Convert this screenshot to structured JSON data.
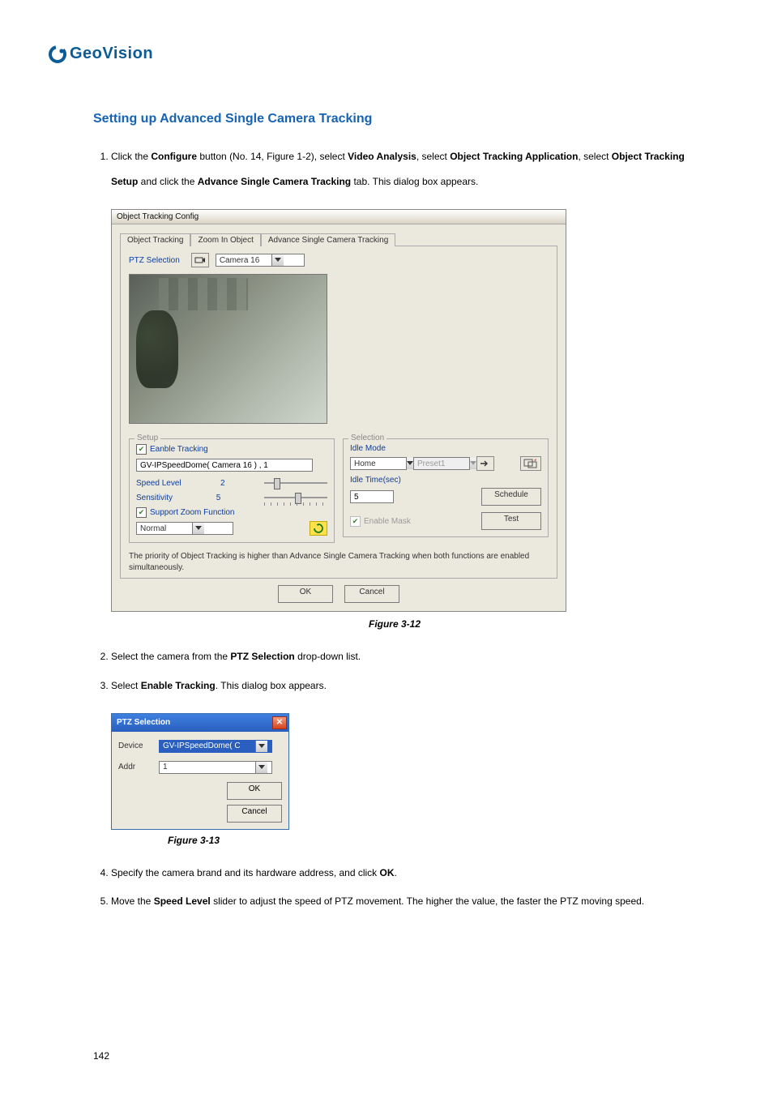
{
  "brand": "GeoVision",
  "section_title": "Setting up Advanced Single Camera Tracking",
  "step1": {
    "pre": "Click the ",
    "b1": "Configure",
    "mid1": " button (No. 14, Figure 1-2), select ",
    "b2": "Video Analysis",
    "mid2": ", select ",
    "b3": "Object Tracking Application",
    "mid3": ", select ",
    "b4": "Object Tracking Setup",
    "mid4": " and click the ",
    "b5": "Advance Single Camera Tracking",
    "mid5": " tab. This dialog box appears."
  },
  "dlg1": {
    "title": "Object Tracking Config",
    "tabs": {
      "t1": "Object Tracking",
      "t2": "Zoom In Object",
      "t3": "Advance Single Camera Tracking"
    },
    "ptz_label": "PTZ Selection",
    "camera": "Camera 16",
    "setup": {
      "legend": "Setup",
      "enable_tracking": "Eanble Tracking",
      "device_line": "GV-IPSpeedDome( Camera 16 ) , 1",
      "speed_label": "Speed Level",
      "speed_val": "2",
      "sens_label": "Sensitivity",
      "sens_val": "5",
      "support_zoom": "Support Zoom Function",
      "normal": "Normal"
    },
    "selection": {
      "legend": "Selection",
      "idle_mode_label": "Idle Mode",
      "idle_mode": "Home",
      "preset": "Preset1",
      "idle_time_label": "Idle Time(sec)",
      "idle_time_val": "5",
      "schedule": "Schedule",
      "enable_mask": "Enable Mask",
      "test": "Test"
    },
    "note": "The priority of Object Tracking is higher than Advance Single Camera Tracking when both functions are enabled simultaneously.",
    "ok": "OK",
    "cancel": "Cancel"
  },
  "fig1": "Figure 3-12",
  "step2": {
    "pre": "Select the camera from the ",
    "b": "PTZ Selection",
    "post": " drop-down list."
  },
  "step3": {
    "pre": "Select ",
    "b": "Enable Tracking",
    "post": ". This dialog box appears."
  },
  "dlg2": {
    "title": "PTZ Selection",
    "device_label": "Device",
    "device_val": "GV-IPSpeedDome( C",
    "addr_label": "Addr",
    "addr_val": "1",
    "ok": "OK",
    "cancel": "Cancel"
  },
  "fig2": "Figure 3-13",
  "step4": {
    "pre": "Specify the camera brand and its hardware address, and click ",
    "b": "OK",
    "post": "."
  },
  "step5": {
    "pre": "Move the ",
    "b": "Speed Level",
    "post": " slider to adjust the speed of PTZ movement. The higher the value, the faster the PTZ moving speed."
  },
  "page_number": "142"
}
